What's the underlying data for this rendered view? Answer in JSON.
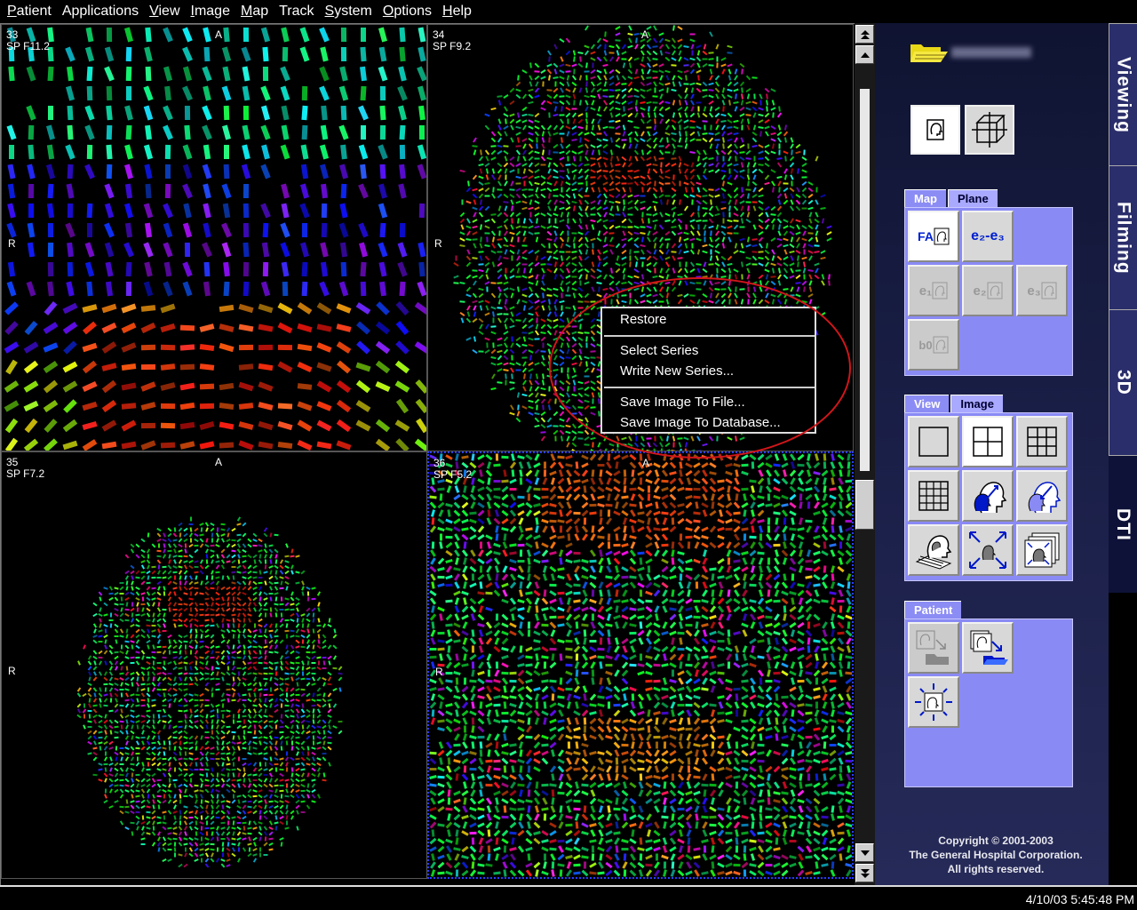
{
  "menu": [
    {
      "mn": "P",
      "rest": "atient"
    },
    {
      "mn": "",
      "rest": "Applications"
    },
    {
      "mn": "V",
      "rest": "iew"
    },
    {
      "mn": "I",
      "rest": "mage"
    },
    {
      "mn": "M",
      "rest": "ap"
    },
    {
      "mn": "",
      "rest": "Track"
    },
    {
      "mn": "S",
      "rest": "ystem"
    },
    {
      "mn": "O",
      "rest": "ptions"
    },
    {
      "mn": "H",
      "rest": "elp"
    }
  ],
  "viewports": [
    {
      "number": "33",
      "slice": "SP F11.2",
      "anterior": "A",
      "right": "R"
    },
    {
      "number": "34",
      "slice": "SP F9.2",
      "anterior": "A",
      "right": "R"
    },
    {
      "number": "35",
      "slice": "SP F7.2",
      "anterior": "A",
      "right": "R"
    },
    {
      "number": "36",
      "slice": "SP F5.2",
      "anterior": "A",
      "right": "R"
    }
  ],
  "context_menu": {
    "restore": "Restore",
    "select_series": "Select Series",
    "write_new_series": "Write New Series...",
    "save_to_file": "Save Image To File...",
    "save_to_database": "Save Image To Database..."
  },
  "map_group": {
    "tabs": [
      "Map",
      "Plane"
    ],
    "fa": "FA",
    "e2e3": "e₂-e₃",
    "e1": "e₁",
    "e2": "e₂",
    "e3": "e₃",
    "b0": "b0"
  },
  "view_group": {
    "tabs": [
      "View",
      "Image"
    ]
  },
  "patient_group": {
    "tabs": [
      "Patient"
    ]
  },
  "mode_tabs": [
    "Viewing",
    "Filming",
    "3D",
    "DTI"
  ],
  "copyright": {
    "line1": "Copyright © 2001-2003",
    "line2": "The General Hospital Corporation.",
    "line3": "All rights reserved."
  },
  "status": {
    "datetime": "4/10/03 5:45:48 PM"
  },
  "colors": {
    "panel_accent": "#8a8af5",
    "highlight_ellipse": "#d0161a"
  }
}
